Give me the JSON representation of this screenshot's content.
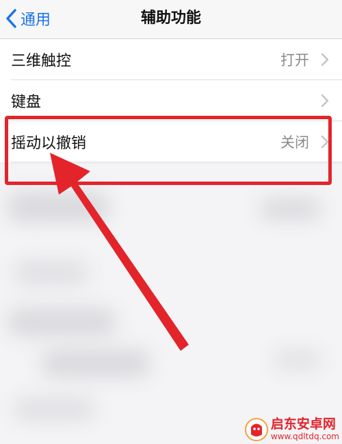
{
  "navbar": {
    "back_label": "通用",
    "title": "辅助功能"
  },
  "rows": [
    {
      "label": "三维触控",
      "value": "打开"
    },
    {
      "label": "键盘",
      "value": ""
    },
    {
      "label": "摇动以撤销",
      "value": "关闭"
    }
  ],
  "annotation": {
    "color": "#e3242b"
  },
  "watermark": {
    "brand": "启东安卓网",
    "url": "www.qdltdq.com"
  },
  "colors": {
    "accent": "#1a73e8",
    "secondary_text": "#8a8a8e",
    "background": "#efeff4"
  }
}
